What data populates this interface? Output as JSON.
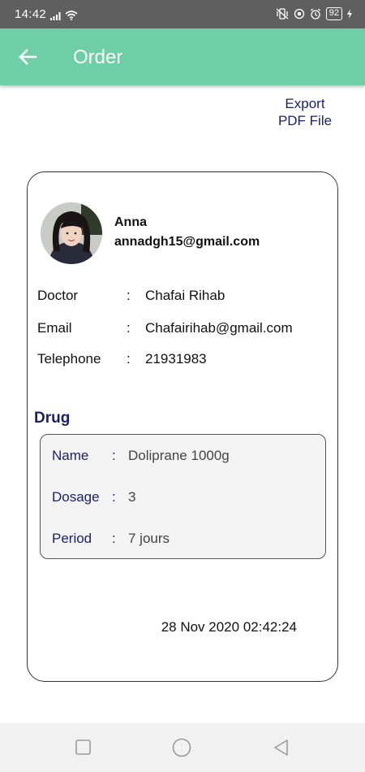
{
  "status_bar": {
    "time": "14:42",
    "battery": "92",
    "icons": [
      "signal-icon",
      "wifi-icon",
      "vibrate-icon",
      "data-saver-icon",
      "alarm-icon",
      "battery-icon",
      "charging-icon"
    ]
  },
  "app_bar": {
    "title": "Order",
    "background": "#6ecfa6"
  },
  "export": {
    "line1": "Export",
    "line2": "PDF File"
  },
  "patient": {
    "name": "Anna",
    "email": "annadgh15@gmail.com"
  },
  "doctor_info": [
    {
      "label": "Doctor",
      "colon": ":",
      "value": "Chafai Rihab"
    },
    {
      "label": "Email",
      "colon": ":",
      "value": "Chafairihab@gmail.com"
    },
    {
      "label": "Telephone",
      "colon": ":",
      "value": "21931983"
    }
  ],
  "drug": {
    "title": "Drug",
    "rows": [
      {
        "label": "Name",
        "colon": ":",
        "value": "Doliprane 1000g"
      },
      {
        "label": "Dosage",
        "colon": ":",
        "value": "3"
      },
      {
        "label": "Period",
        "colon": ":",
        "value": "7 jours"
      }
    ]
  },
  "order_date": "28 Nov 2020 02:42:24",
  "nav": [
    "recents-icon",
    "home-icon",
    "back-triangle-icon"
  ]
}
